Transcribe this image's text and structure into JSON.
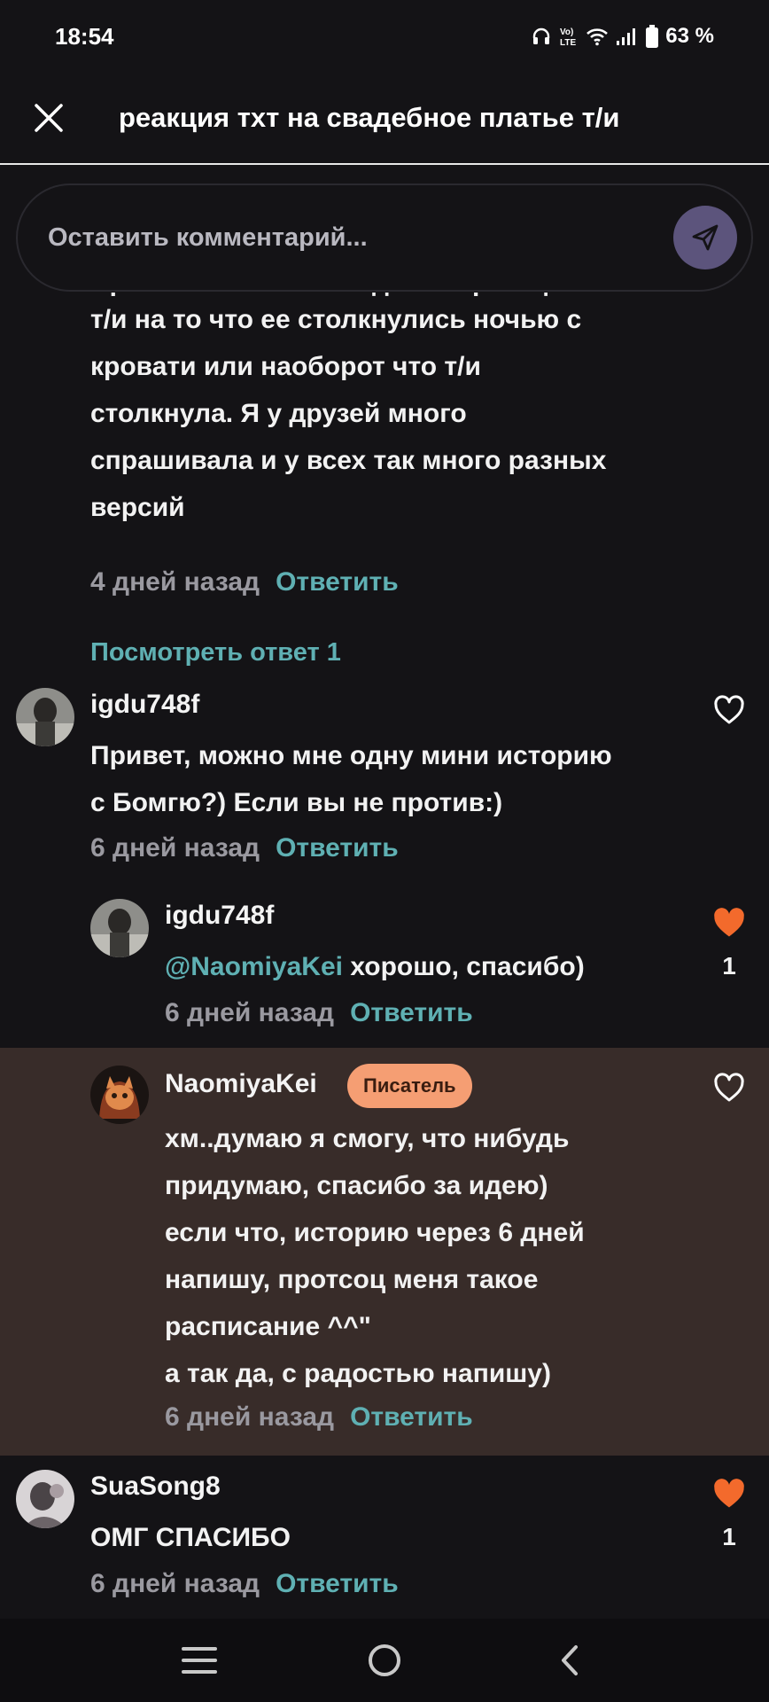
{
  "status": {
    "time": "18:54",
    "network": "Vo) LTE",
    "battery": "63 %"
  },
  "header": {
    "title": "реакция тхт на свадебное платье т/и"
  },
  "comment_input": {
    "placeholder": "Оставить комментарий..."
  },
  "first_comment": {
    "cut_line": "Привет. Можешь пж сделать реакцию",
    "text": "т/и на то что ее столкнулись ночью с\nкровати или наоборот  что т/и\nстолкнула. Я у друзей много\nспрашивала и у всех так много разных\nверсий",
    "time": "4 дней назад",
    "reply": "Ответить"
  },
  "view_replies": "Посмотреть ответ 1",
  "comments": [
    {
      "username": "igdu748f",
      "text": "Привет, можно мне одну мини историю\nс Бомгю?) Если вы не против:)",
      "time": "6 дней назад",
      "reply": "Ответить"
    },
    {
      "username": "igdu748f",
      "mention": "@NaomiyaKei",
      "text": " хорошо, спасибо)",
      "time": "6 дней назад",
      "reply": "Ответить",
      "likes": "1",
      "liked": true
    },
    {
      "username": "NaomiyaKei",
      "badge": "Писатель",
      "text": "хм..думаю я смогу, что нибудь\nпридумаю, спасибо за идею)\nесли что, историю через 6 дней\nнапишу, протсоц меня такое\nрасписание ^^\"\nа так да, с радостью напишу)",
      "time": "6 дней назад",
      "reply": "Ответить"
    },
    {
      "username": "SuaSong8",
      "text": "ОМГ СПАСИБО",
      "time": "6 дней назад",
      "reply": "Ответить",
      "likes": "1",
      "liked": true
    }
  ],
  "colors": {
    "accent": "#5fb0b3",
    "liked": "#f36a2c",
    "badge": "#f59e73",
    "highlight": "#382c29",
    "send": "#5c547c"
  }
}
